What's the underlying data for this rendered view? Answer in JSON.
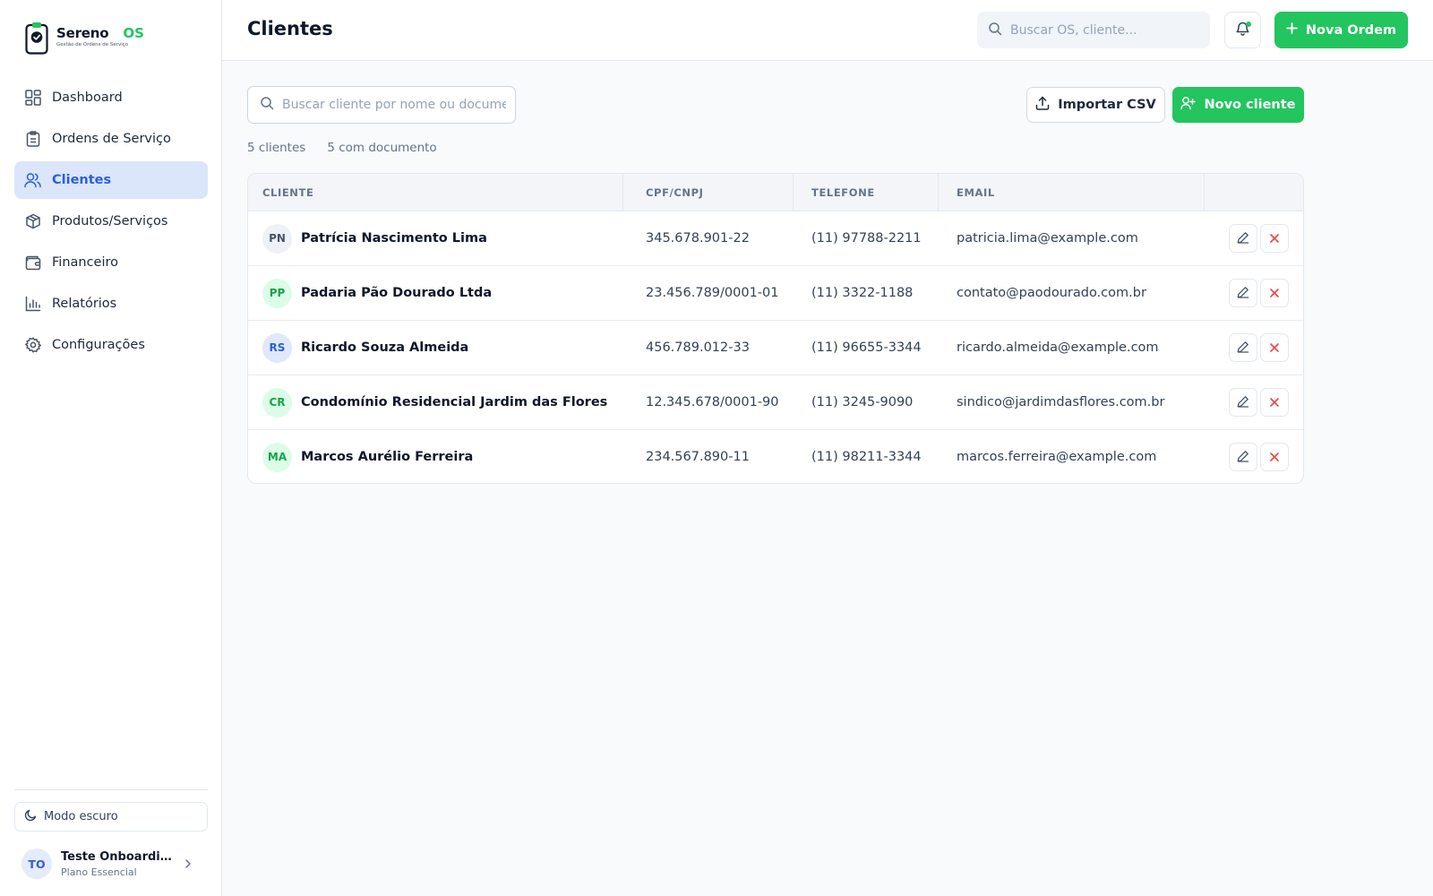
{
  "brand": {
    "name": "Sereno",
    "suffix": "OS",
    "tagline": "Gestão de Ordens de Serviço",
    "accent_color": "#22c55e",
    "primary_color": "#2d5fd3"
  },
  "sidebar": {
    "items": [
      {
        "label": "Dashboard",
        "icon": "dashboard-icon"
      },
      {
        "label": "Ordens de Serviço",
        "icon": "clipboard-icon"
      },
      {
        "label": "Clientes",
        "icon": "users-icon",
        "active": true
      },
      {
        "label": "Produtos/Serviços",
        "icon": "package-icon"
      },
      {
        "label": "Financeiro",
        "icon": "wallet-icon"
      },
      {
        "label": "Relatórios",
        "icon": "bar-chart-icon"
      },
      {
        "label": "Configurações",
        "icon": "gear-icon"
      }
    ],
    "dark_mode_label": "Modo escuro",
    "user": {
      "initials": "TO",
      "name": "Teste Onboarding...",
      "plan": "Plano Essencial"
    }
  },
  "header": {
    "title": "Clientes",
    "search_placeholder": "Buscar OS, cliente...",
    "new_order_label": "Nova Ordem"
  },
  "toolbar": {
    "search_placeholder": "Buscar cliente por nome ou documento",
    "import_label": "Importar CSV",
    "new_client_label": "Novo cliente"
  },
  "summary": {
    "clients_count": "5 clientes",
    "with_document": "5 com documento"
  },
  "table": {
    "columns": [
      "CLIENTE",
      "CPF/CNPJ",
      "TELEFONE",
      "EMAIL"
    ],
    "rows": [
      {
        "initials": "PN",
        "name": "Patrícia Nascimento Lima",
        "document": "345.678.901-22",
        "phone": "(11) 97788-2211",
        "email": "patricia.lima@example.com",
        "avatar_bg": "#eef1f5",
        "avatar_fg": "#475569"
      },
      {
        "initials": "PP",
        "name": "Padaria Pão Dourado Ltda",
        "document": "23.456.789/0001-01",
        "phone": "(11) 3322-1188",
        "email": "contato@paodourado.com.br",
        "avatar_bg": "#dcfce7",
        "avatar_fg": "#16a34a"
      },
      {
        "initials": "RS",
        "name": "Ricardo Souza Almeida",
        "document": "456.789.012-33",
        "phone": "(11) 96655-3344",
        "email": "ricardo.almeida@example.com",
        "avatar_bg": "#e0e8fb",
        "avatar_fg": "#2d5fd3"
      },
      {
        "initials": "CR",
        "name": "Condomínio Residencial Jardim das Flores",
        "document": "12.345.678/0001-90",
        "phone": "(11) 3245-9090",
        "email": "sindico@jardimdasflores.com.br",
        "avatar_bg": "#dcfce7",
        "avatar_fg": "#16a34a"
      },
      {
        "initials": "MA",
        "name": "Marcos Aurélio Ferreira",
        "document": "234.567.890-11",
        "phone": "(11) 98211-3344",
        "email": "marcos.ferreira@example.com",
        "avatar_bg": "#dcfce7",
        "avatar_fg": "#16a34a"
      }
    ]
  }
}
